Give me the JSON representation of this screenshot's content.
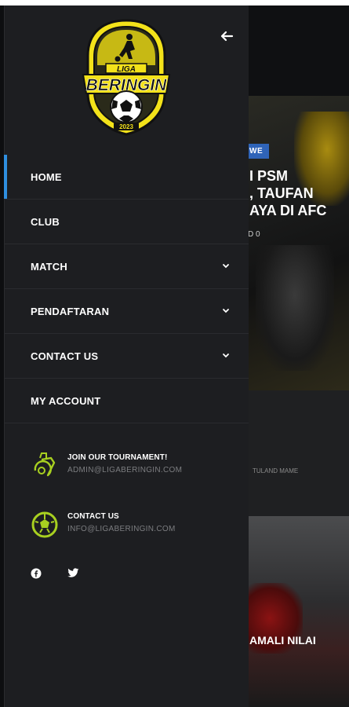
{
  "menu": {
    "items": [
      {
        "label": "HOME",
        "active": true,
        "has_submenu": false
      },
      {
        "label": "CLUB",
        "active": false,
        "has_submenu": false
      },
      {
        "label": "MATCH",
        "active": false,
        "has_submenu": true
      },
      {
        "label": "PENDAFTARAN",
        "active": false,
        "has_submenu": true
      },
      {
        "label": "CONTACT US",
        "active": false,
        "has_submenu": true
      },
      {
        "label": "MY ACCOUNT",
        "active": false,
        "has_submenu": false
      }
    ]
  },
  "logo": {
    "top_text": "LIGA",
    "main_text": "BERINGIN",
    "year": "2023"
  },
  "contacts": [
    {
      "icon": "whistle-icon",
      "title": "JOIN OUR TOURNAMENT!",
      "email": "ADMIN@LIGABERINGIN.COM"
    },
    {
      "icon": "ball-icon",
      "title": "CONTACT US",
      "email": "INFO@LIGABERINGIN.COM"
    }
  ],
  "social": [
    {
      "icon": "facebook-icon"
    },
    {
      "icon": "twitter-icon"
    }
  ],
  "background": {
    "tag": "WE",
    "headline": "I PSM\n, TAUFAN\nAYA DI AFC",
    "count": "D 0",
    "strip_text": "TULAND MAME",
    "card_text": "AMALI NILAI"
  },
  "colors": {
    "accent": "#2f8fe0",
    "sidebar_bg": "#1d1e21",
    "icon_green": "#a8d020",
    "logo_yellow": "#f3e21a"
  }
}
